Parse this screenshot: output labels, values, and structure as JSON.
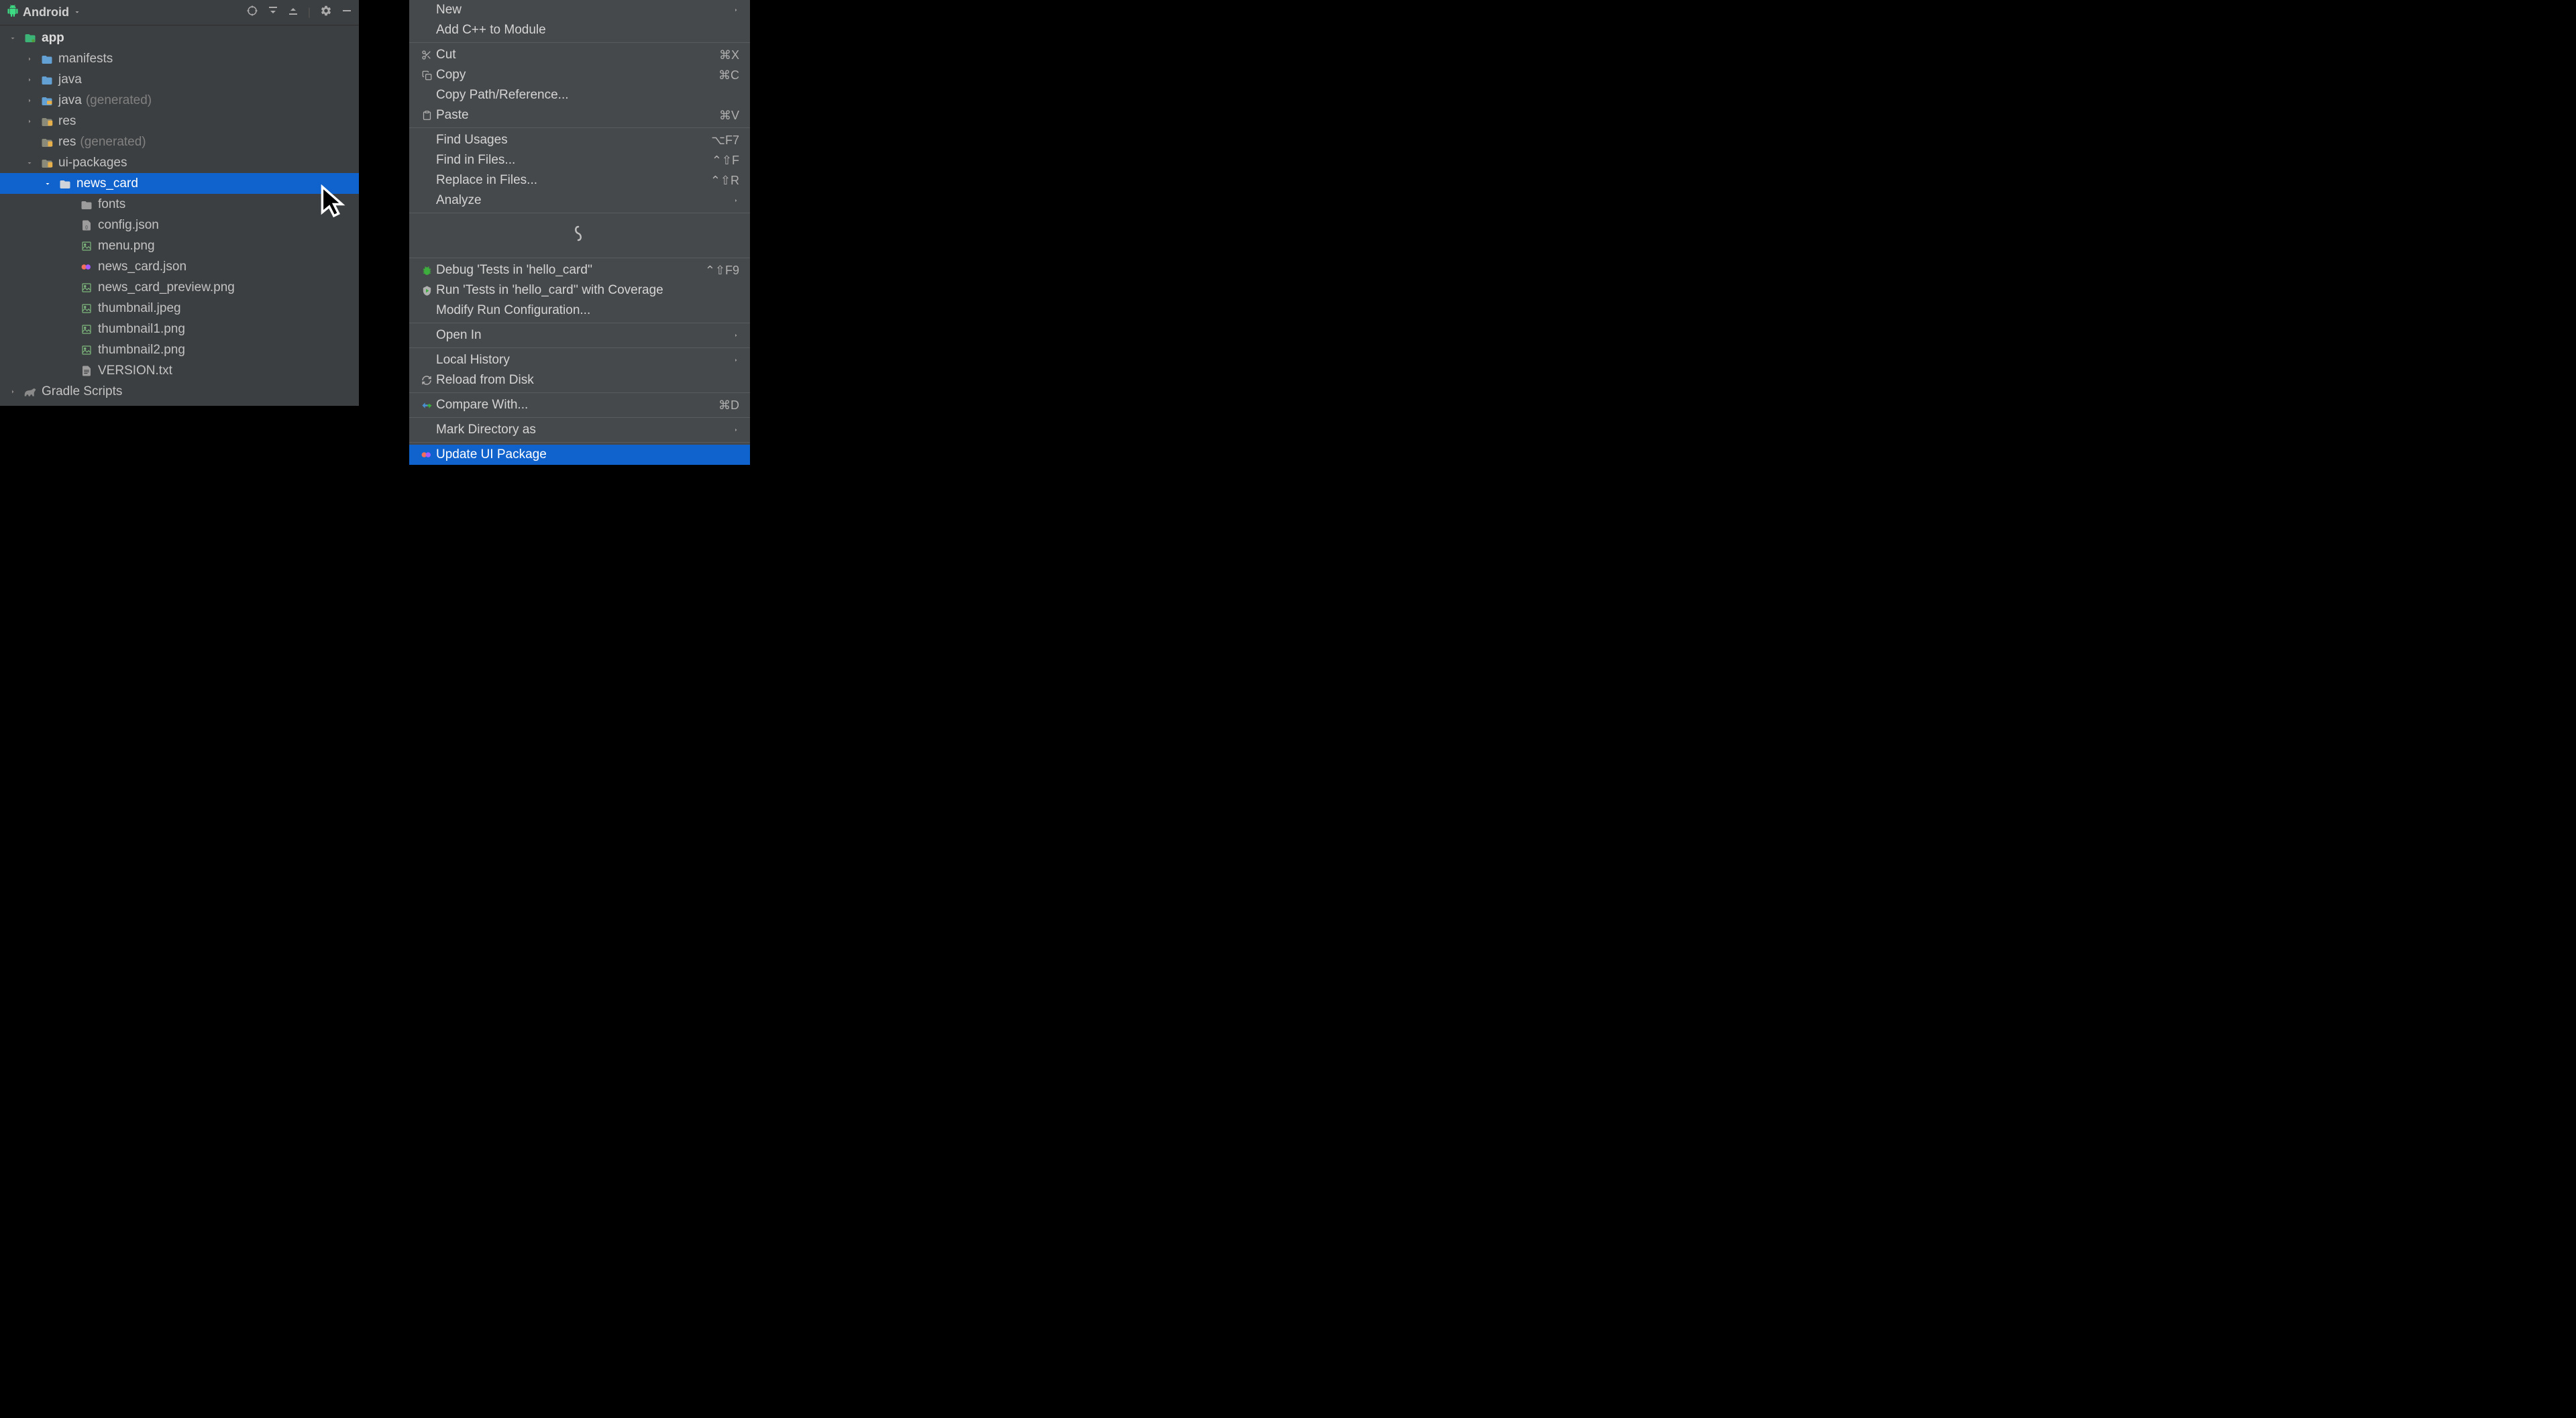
{
  "panel": {
    "title": "Android"
  },
  "tree": {
    "app": "app",
    "manifests": "manifests",
    "java": "java",
    "java_gen": "java",
    "java_gen_suffix": "(generated)",
    "res": "res",
    "res_gen": "res",
    "res_gen_suffix": "(generated)",
    "ui_packages": "ui-packages",
    "news_card": "news_card",
    "fonts": "fonts",
    "config_json": "config.json",
    "menu_png": "menu.png",
    "news_card_json": "news_card.json",
    "news_card_preview": "news_card_preview.png",
    "thumbnail_jpeg": "thumbnail.jpeg",
    "thumbnail1": "thumbnail1.png",
    "thumbnail2": "thumbnail2.png",
    "version_txt": "VERSION.txt",
    "gradle_scripts": "Gradle Scripts"
  },
  "menu": {
    "new": "New",
    "add_cpp": "Add C++ to Module",
    "cut": "Cut",
    "cut_key": "⌘X",
    "copy": "Copy",
    "copy_key": "⌘C",
    "copy_path": "Copy Path/Reference...",
    "paste": "Paste",
    "paste_key": "⌘V",
    "find_usages": "Find Usages",
    "find_usages_key": "⌥F7",
    "find_in_files": "Find in Files...",
    "find_in_files_key": "⌃⇧F",
    "replace_in_files": "Replace in Files...",
    "replace_in_files_key": "⌃⇧R",
    "analyze": "Analyze",
    "debug_tests": "Debug 'Tests in 'hello_card''",
    "debug_tests_key": "⌃⇧F9",
    "run_coverage": "Run 'Tests in 'hello_card'' with Coverage",
    "modify_run": "Modify Run Configuration...",
    "open_in": "Open In",
    "local_history": "Local History",
    "reload": "Reload from Disk",
    "compare": "Compare With...",
    "compare_key": "⌘D",
    "mark_dir": "Mark Directory as",
    "update_ui": "Update UI Package"
  }
}
